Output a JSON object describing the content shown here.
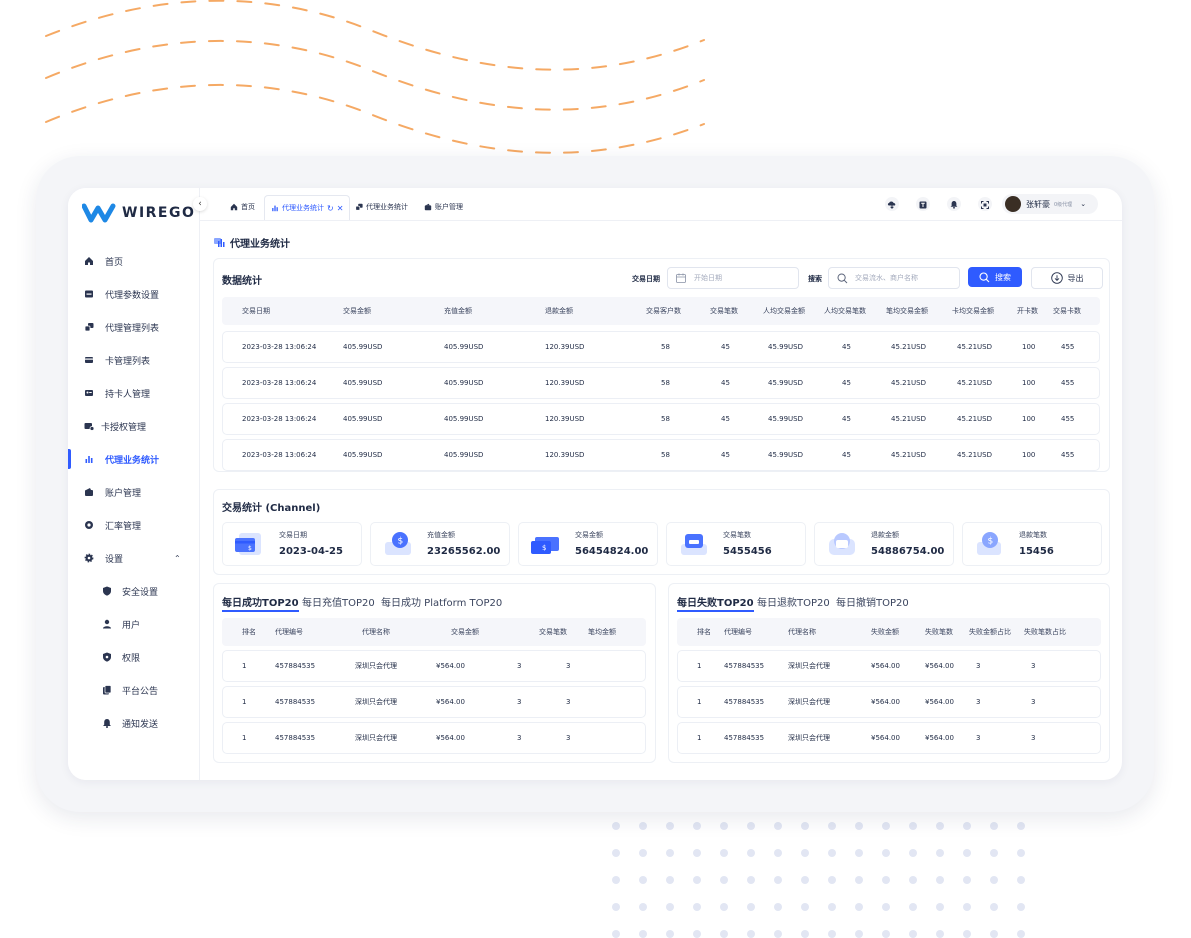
{
  "brand": {
    "name": "WIREGO"
  },
  "sidebar": {
    "items": [
      {
        "label": "首页",
        "icon": "home-icon"
      },
      {
        "label": "代理参数设置",
        "icon": "settings-box-icon"
      },
      {
        "label": "代理管理列表",
        "icon": "agent-list-icon"
      },
      {
        "label": "卡管理列表",
        "icon": "card-icon"
      },
      {
        "label": "持卡人管理",
        "icon": "id-card-icon"
      },
      {
        "label": "卡授权管理",
        "icon": "card-auth-icon"
      },
      {
        "label": "代理业务统计",
        "icon": "bar-chart-icon",
        "active": true
      },
      {
        "label": "账户管理",
        "icon": "wallet-icon"
      },
      {
        "label": "汇率管理",
        "icon": "exchange-icon"
      },
      {
        "label": "设置",
        "icon": "gear-icon"
      }
    ],
    "sub_items": [
      {
        "label": "安全设置",
        "icon": "shield-icon"
      },
      {
        "label": "用户",
        "icon": "user-icon"
      },
      {
        "label": "权限",
        "icon": "permission-icon"
      },
      {
        "label": "平台公告",
        "icon": "notice-icon"
      },
      {
        "label": "通知发送",
        "icon": "bell-icon"
      }
    ]
  },
  "tabs": [
    {
      "label": "首页"
    },
    {
      "label": "代理业务统计",
      "active": true
    },
    {
      "label": "代理业务统计"
    },
    {
      "label": "账户管理"
    }
  ],
  "user": {
    "name": "张轩豪",
    "role": "0级代理"
  },
  "page": {
    "title": "代理业务统计"
  },
  "data_stats": {
    "title": "数据统计",
    "date_label": "交易日期",
    "date_placeholder": "开始日期",
    "search_label": "搜索",
    "search_placeholder": "交易流水、商户名称",
    "search_button": "搜索",
    "export_button": "导出",
    "columns": [
      "交易日期",
      "交易金额",
      "充值金额",
      "退款金额",
      "交易客户数",
      "交易笔数",
      "人均交易金额",
      "人均交易笔数",
      "笔均交易金额",
      "卡均交易金额",
      "开卡数",
      "交易卡数"
    ],
    "rows": [
      [
        "2023-03-28 13:06:24",
        "405.99USD",
        "405.99USD",
        "120.39USD",
        "58",
        "45",
        "45.99USD",
        "45",
        "45.21USD",
        "45.21USD",
        "100",
        "455"
      ],
      [
        "2023-03-28 13:06:24",
        "405.99USD",
        "405.99USD",
        "120.39USD",
        "58",
        "45",
        "45.99USD",
        "45",
        "45.21USD",
        "45.21USD",
        "100",
        "455"
      ],
      [
        "2023-03-28 13:06:24",
        "405.99USD",
        "405.99USD",
        "120.39USD",
        "58",
        "45",
        "45.99USD",
        "45",
        "45.21USD",
        "45.21USD",
        "100",
        "455"
      ],
      [
        "2023-03-28 13:06:24",
        "405.99USD",
        "405.99USD",
        "120.39USD",
        "58",
        "45",
        "45.99USD",
        "45",
        "45.21USD",
        "45.21USD",
        "100",
        "455"
      ]
    ]
  },
  "channel_stats": {
    "title": "交易统计 (Channel)",
    "cards": [
      {
        "label": "交易日期",
        "value": "2023-04-25"
      },
      {
        "label": "充值金额",
        "value": "23265562.00"
      },
      {
        "label": "交易金额",
        "value": "56454824.00"
      },
      {
        "label": "交易笔数",
        "value": "5455456"
      },
      {
        "label": "退款金额",
        "value": "54886754.00"
      },
      {
        "label": "退款笔数",
        "value": "15456"
      }
    ]
  },
  "success_top": {
    "tabs": [
      "每日成功TOP20",
      "每日充值TOP20",
      "每日成功 Platform TOP20"
    ],
    "columns": [
      "排名",
      "代理编号",
      "代理名称",
      "交易金额",
      "交易笔数",
      "笔均金额"
    ],
    "rows": [
      [
        "1",
        "457884535",
        "深圳只会代理",
        "¥564.00",
        "3",
        "3"
      ],
      [
        "1",
        "457884535",
        "深圳只会代理",
        "¥564.00",
        "3",
        "3"
      ],
      [
        "1",
        "457884535",
        "深圳只会代理",
        "¥564.00",
        "3",
        "3"
      ]
    ]
  },
  "fail_top": {
    "tabs": [
      "每日失败TOP20",
      "每日退款TOP20",
      "每日撤销TOP20"
    ],
    "columns": [
      "排名",
      "代理编号",
      "代理名称",
      "失败金额",
      "失败笔数",
      "失败金额占比",
      "失败笔数占比"
    ],
    "rows": [
      [
        "1",
        "457884535",
        "深圳只会代理",
        "¥564.00",
        "¥564.00",
        "3",
        "3"
      ],
      [
        "1",
        "457884535",
        "深圳只会代理",
        "¥564.00",
        "¥564.00",
        "3",
        "3"
      ],
      [
        "1",
        "457884535",
        "深圳只会代理",
        "¥564.00",
        "¥564.00",
        "3",
        "3"
      ]
    ]
  },
  "colors": {
    "accent": "#2f5bff",
    "wave": "#f5a964",
    "dots": "#e2e6f3"
  }
}
